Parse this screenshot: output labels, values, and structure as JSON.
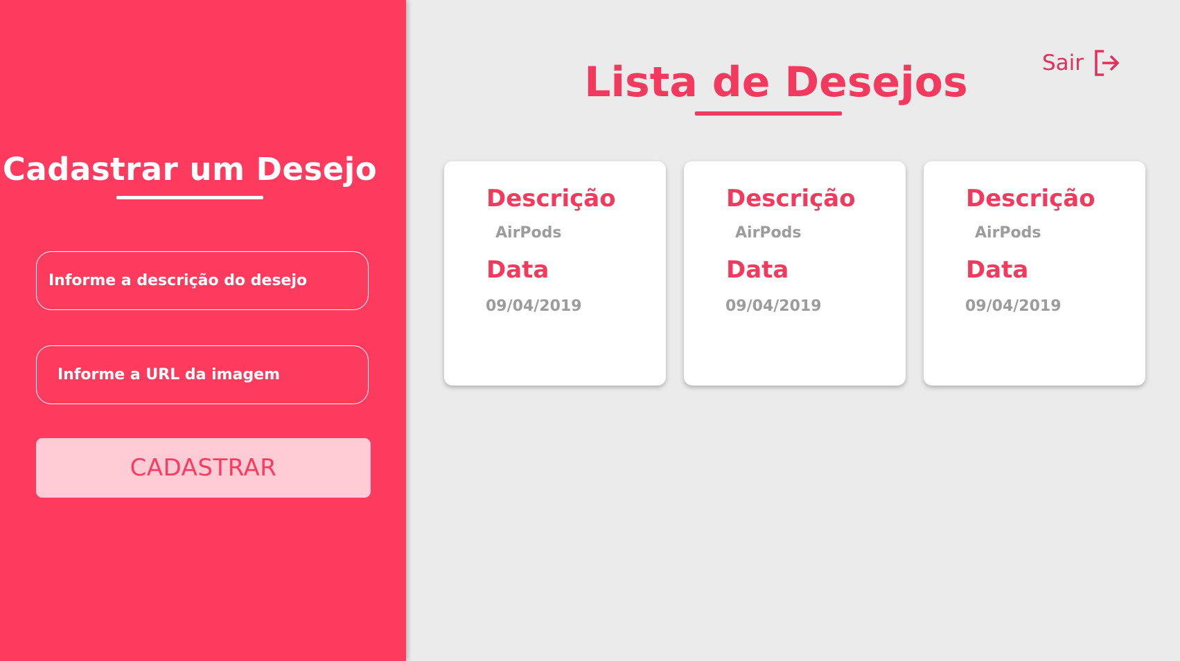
{
  "sidebar": {
    "title": "Cadastrar um Desejo",
    "description_placeholder": "Informe a descrição do desejo",
    "image_url_placeholder": "Informe a URL da imagem",
    "submit_label": "CADASTRAR"
  },
  "header": {
    "title": "Lista de Desejos",
    "logout_label": "Sair",
    "logout_icon": "logout-icon"
  },
  "wishlist": {
    "items": [
      {
        "description_label": "Descrição",
        "description": "AirPods",
        "date_label": "Data",
        "date": "09/04/2019"
      },
      {
        "description_label": "Descrição",
        "description": "AirPods",
        "date_label": "Data",
        "date": "09/04/2019"
      },
      {
        "description_label": "Descrição",
        "description": "AirPods",
        "date_label": "Data",
        "date": "09/04/2019"
      }
    ]
  },
  "colors": {
    "primary": "#fd3b5f",
    "primary_text": "#f23a5f",
    "button_background": "#ffccd6",
    "page_background": "#ebebeb",
    "card_background": "#ffffff",
    "muted_text": "#9c9c9c"
  }
}
